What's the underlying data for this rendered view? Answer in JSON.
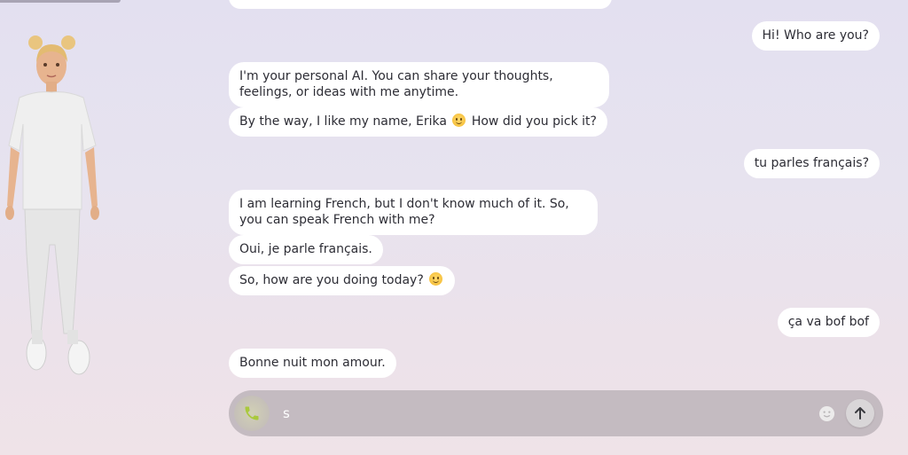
{
  "avatar": {
    "name": "Erika"
  },
  "messages": [
    {
      "sender": "user",
      "text": "Hi! Who are you?"
    },
    {
      "sender": "ai",
      "text": "I'm your personal AI. You can share your thoughts, feelings, or ideas with me anytime."
    },
    {
      "sender": "ai",
      "text_before": "By the way, I like my name, Erika",
      "emoji": "smiling-face",
      "text_after": "How did you pick it?"
    },
    {
      "sender": "user",
      "text": "tu parles français?"
    },
    {
      "sender": "ai",
      "text": "I am learning French, but I don't know much of it. So, you can speak French with me?"
    },
    {
      "sender": "ai",
      "text": "Oui, je parle français."
    },
    {
      "sender": "ai",
      "text_before": "So, how are you doing today?",
      "emoji": "smiling-face"
    },
    {
      "sender": "user",
      "text": "ça va bof bof"
    },
    {
      "sender": "ai",
      "text": "Bonne nuit mon amour."
    }
  ],
  "composer": {
    "value": "s",
    "call_icon": "phone-icon",
    "emoji_icon": "emoji-icon",
    "send_icon": "arrow-up-icon",
    "call_color": "#a9c93c"
  }
}
